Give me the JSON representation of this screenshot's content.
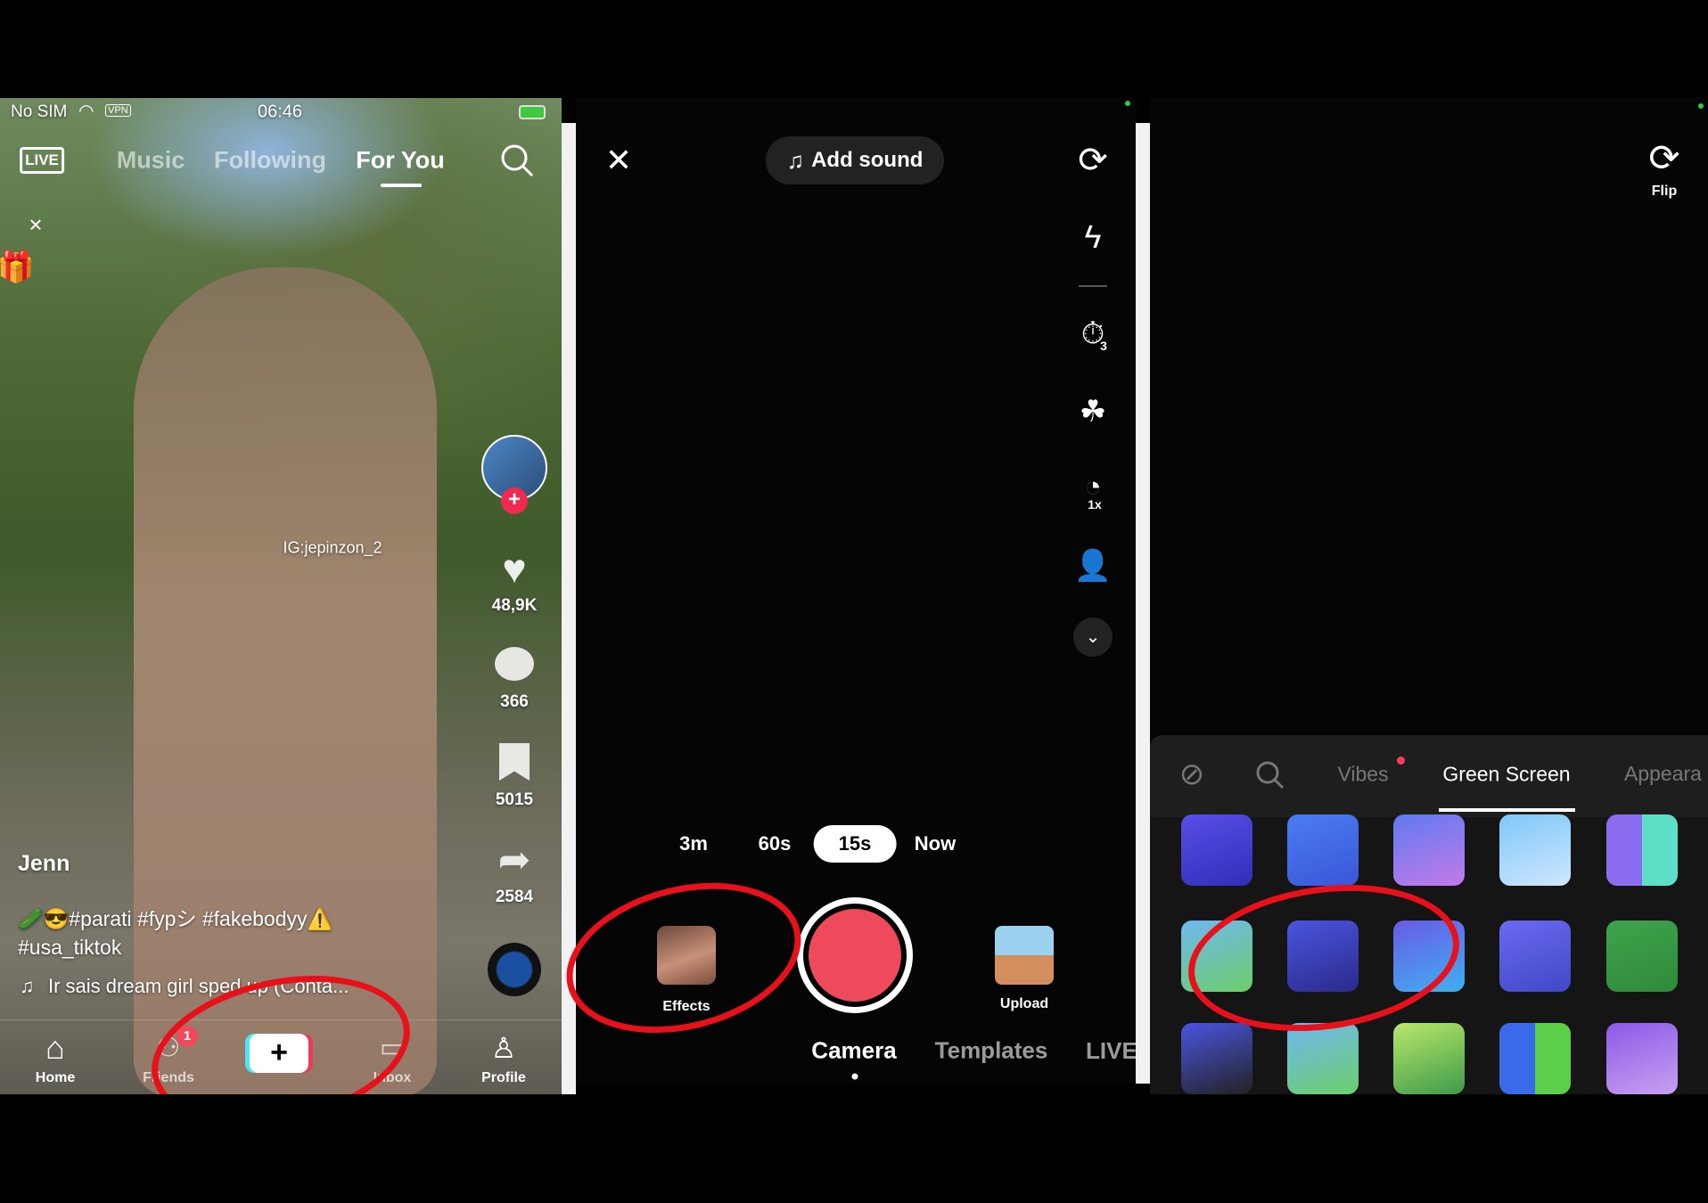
{
  "feed": {
    "status": {
      "carrier": "No SIM",
      "vpn": "VPN",
      "time": "06:46"
    },
    "top_nav": {
      "live": "LIVE",
      "tabs": [
        "Music",
        "Following",
        "For You"
      ],
      "active": "For You"
    },
    "watermark": "IG:jepinzon_2",
    "counts": {
      "likes": "48,9K",
      "comments": "366",
      "saves": "5015",
      "shares": "2584"
    },
    "author": "Jenn",
    "caption_line1": "🥒😎#parati #fypシ #fakebodyy⚠️",
    "caption_line2": "#usa_tiktok",
    "sound": "Ir sais dream girl sped up (Conta...",
    "bottom_nav": {
      "home": "Home",
      "friends": "Friends",
      "friends_badge": "1",
      "inbox": "Inbox",
      "profile": "Profile"
    }
  },
  "camera": {
    "add_sound": "Add sound",
    "durations": [
      "3m",
      "60s",
      "15s",
      "Now"
    ],
    "selected_duration": "15s",
    "speed": "1x",
    "timer": "3",
    "effects": "Effects",
    "upload": "Upload",
    "modes": [
      "Camera",
      "Templates",
      "LIVE"
    ],
    "active_mode": "Camera"
  },
  "effects_panel": {
    "flip": "Flip",
    "tabs": [
      "Vibes",
      "Green Screen",
      "Appeara"
    ],
    "active_tab": "Green Screen"
  },
  "colors": {
    "record": "#ef4a5b",
    "annotation": "#e8101a",
    "accent_dot": "#ff3b5c",
    "green_dot": "#2ecc40"
  }
}
